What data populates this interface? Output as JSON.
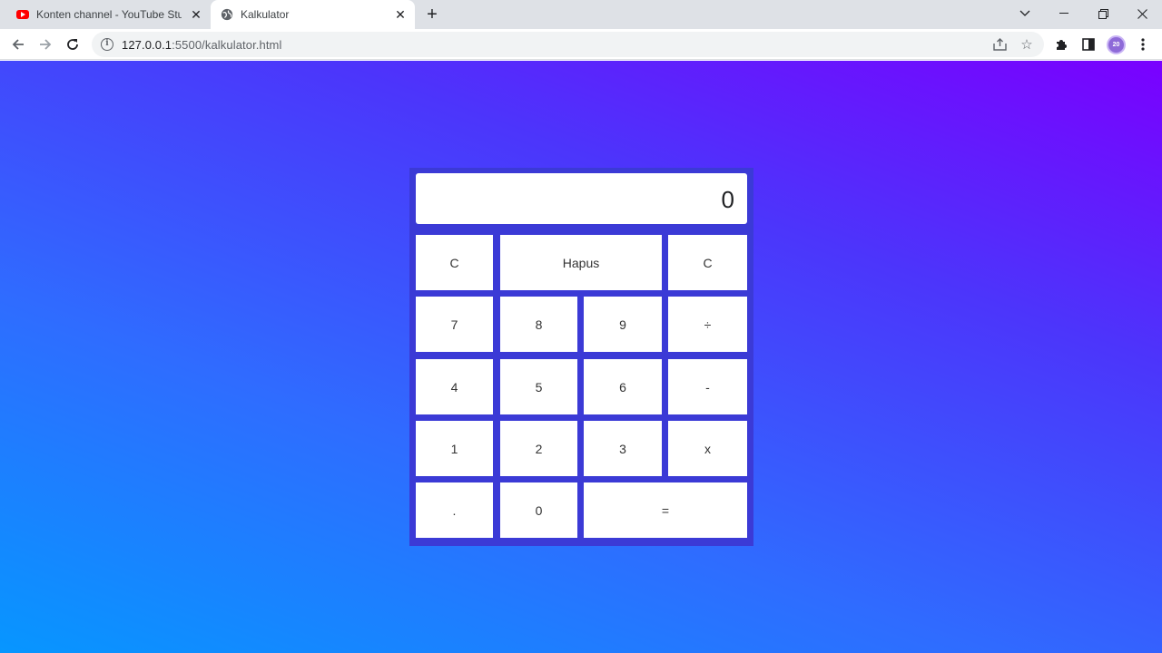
{
  "browser": {
    "tabs": [
      {
        "title": "Konten channel - YouTube Studio",
        "icon": "youtube-icon",
        "active": false
      },
      {
        "title": "Kalkulator",
        "icon": "globe-icon",
        "active": true
      }
    ],
    "url_host": "127.0.0.1",
    "url_path": ":5500/kalkulator.html",
    "profile_initials": "20"
  },
  "calculator": {
    "display": "0",
    "keys": {
      "clear_left": "C",
      "delete": "Hapus",
      "clear_right": "C",
      "seven": "7",
      "eight": "8",
      "nine": "9",
      "divide": "÷",
      "four": "4",
      "five": "5",
      "six": "6",
      "minus": "-",
      "one": "1",
      "two": "2",
      "three": "3",
      "times": "x",
      "dot": ".",
      "zero": "0",
      "equals": "="
    }
  },
  "colors": {
    "gradient_top": "#7a00ff",
    "gradient_bottom": "#0796ff",
    "calculator_frame": "#3b3ad6"
  }
}
